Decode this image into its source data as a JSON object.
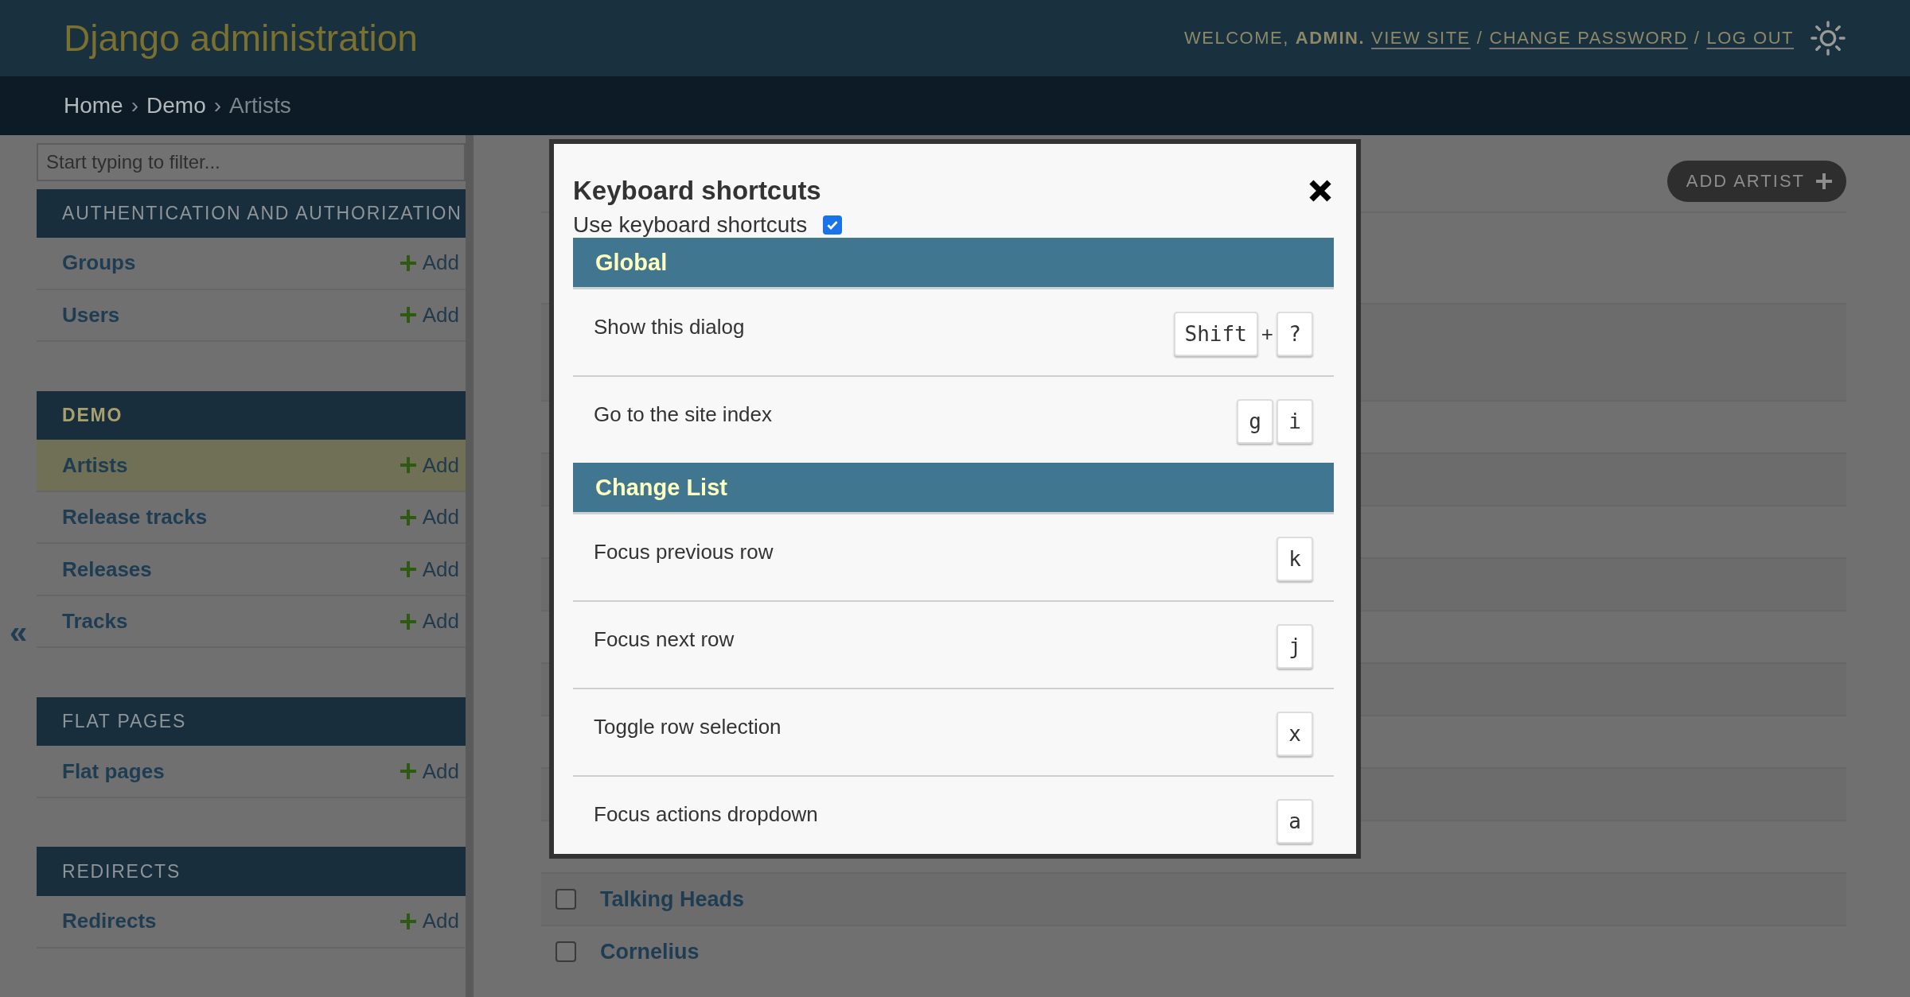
{
  "header": {
    "title": "Django administration",
    "welcome": "WELCOME,",
    "username": "ADMIN.",
    "links": [
      {
        "label": "VIEW SITE"
      },
      {
        "separator": "/",
        "label": "CHANGE PASSWORD"
      },
      {
        "separator": "/",
        "label": "LOG OUT"
      }
    ]
  },
  "breadcrumbs": [
    {
      "label": "Home",
      "current": false
    },
    {
      "separator": "›",
      "label": "Demo",
      "current": false
    },
    {
      "separator": "›",
      "label": "Artists",
      "current": true
    }
  ],
  "sidebar": {
    "collapse_button": "«",
    "filter": {
      "placeholder": "Start typing to filter..."
    },
    "modules": [
      {
        "name": "AUTHENTICATION AND AUTHORIZATION",
        "current": false,
        "models": [
          {
            "name": "Groups",
            "add": "Add",
            "selected": false
          },
          {
            "name": "Users",
            "add": "Add",
            "selected": false
          }
        ]
      },
      {
        "name": "DEMO",
        "current": true,
        "models": [
          {
            "name": "Artists",
            "add": "Add",
            "selected": true
          },
          {
            "name": "Release tracks",
            "add": "Add",
            "selected": false
          },
          {
            "name": "Releases",
            "add": "Add",
            "selected": false
          },
          {
            "name": "Tracks",
            "add": "Add",
            "selected": false
          }
        ]
      },
      {
        "name": "FLAT PAGES",
        "current": false,
        "models": [
          {
            "name": "Flat pages",
            "add": "Add",
            "selected": false
          }
        ]
      },
      {
        "name": "REDIRECTS",
        "current": false,
        "models": [
          {
            "name": "Redirects",
            "add": "Add",
            "selected": false
          }
        ]
      }
    ]
  },
  "content": {
    "add_button": "ADD ARTIST",
    "rows": [
      {
        "name": "Talking Heads",
        "checked": false
      },
      {
        "name": "Cornelius",
        "checked": false
      }
    ]
  },
  "dialog": {
    "title": "Keyboard shortcuts",
    "use_shortcuts": {
      "label": "Use keyboard shortcuts",
      "checked": true
    },
    "sections": [
      {
        "title": "Global",
        "shortcuts": [
          {
            "description": "Show this dialog",
            "keys": [
              {
                "kind": "key",
                "text": "Shift"
              },
              {
                "kind": "joiner",
                "text": "+"
              },
              {
                "kind": "key",
                "text": "?"
              }
            ]
          },
          {
            "description": "Go to the site index",
            "keys": [
              {
                "kind": "key",
                "text": "g"
              },
              {
                "kind": "key",
                "text": "i"
              }
            ]
          }
        ]
      },
      {
        "title": "Change List",
        "shortcuts": [
          {
            "description": "Focus previous row",
            "keys": [
              {
                "kind": "key",
                "text": "k"
              }
            ]
          },
          {
            "description": "Focus next row",
            "keys": [
              {
                "kind": "key",
                "text": "j"
              }
            ]
          },
          {
            "description": "Toggle row selection",
            "keys": [
              {
                "kind": "key",
                "text": "x"
              }
            ]
          },
          {
            "description": "Focus actions dropdown",
            "keys": [
              {
                "kind": "key",
                "text": "a"
              }
            ]
          }
        ]
      }
    ]
  }
}
